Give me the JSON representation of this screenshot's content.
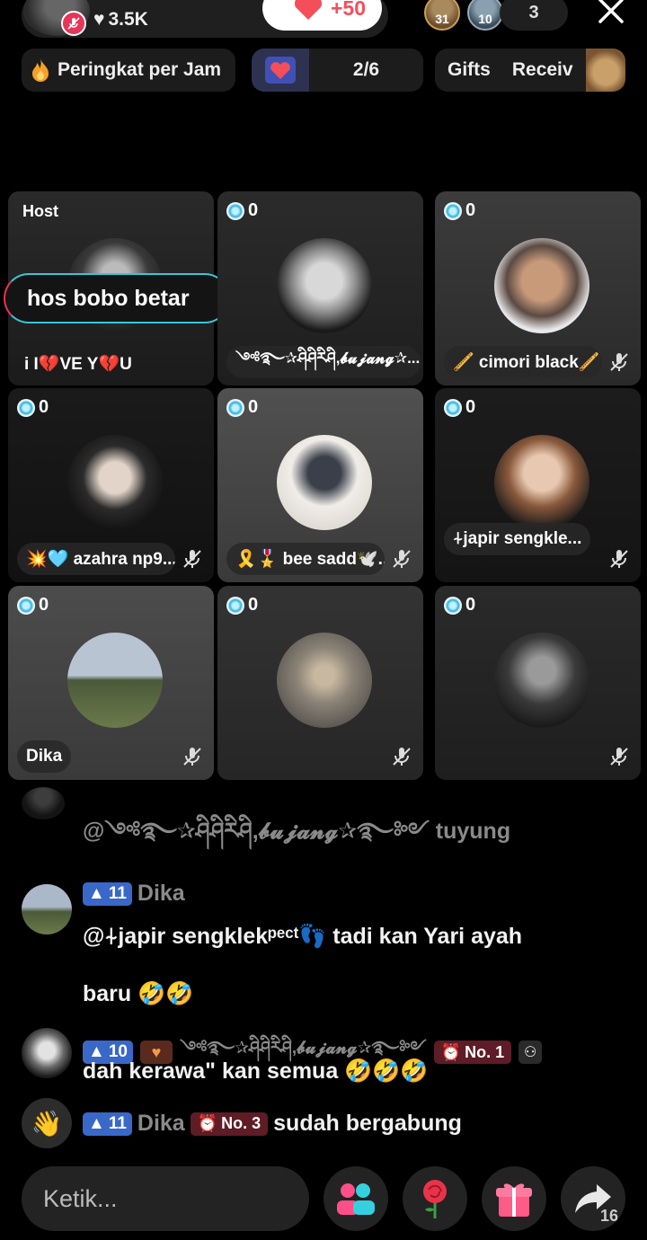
{
  "header": {
    "likes": "3.5K",
    "like_increment": "+50",
    "viewer_badges": [
      "31",
      "10"
    ],
    "viewer_count": "3"
  },
  "chips": {
    "ranking": "Peringkat per Jam",
    "goal_progress": "2/6",
    "gifts": "Gifts",
    "received": "Receiv"
  },
  "host": {
    "label": "Host",
    "speech": "hos bobo betar",
    "name": "i I💔VE Y💔U"
  },
  "seats": [
    {
      "count": "0",
      "name": "༺࿐✰ཤིཤིརིཤི,𝓫𝓾𝓳𝓪𝓷𝓰✰..."
    },
    {
      "count": "0",
      "name": "🪈 cimori black🪈"
    },
    {
      "count": "0",
      "name": "💥🩵 azahra np9..."
    },
    {
      "count": "0",
      "name": "🎗️🎖️ bee sadd🕊️..."
    },
    {
      "count": "0",
      "name": "⍭japir sengkle..."
    },
    {
      "count": "0",
      "name": "Dika"
    },
    {
      "count": "0",
      "name": ""
    },
    {
      "count": "0",
      "name": ""
    }
  ],
  "chat": {
    "msg0": {
      "text": "@༺࿐✰ཤིཤིརིཤི,𝓫𝓾𝓳𝓪𝓷𝓰✰࿐༻ tuyung"
    },
    "msg1": {
      "level": "11",
      "user": "Dika",
      "line1": "@⍭japir sengklekᵖᵉᶜᵗ👣 tadi kan Yari ayah",
      "line2": "baru 🤣🤣"
    },
    "msg2": {
      "level": "10",
      "user": "༺࿐✰ཤིཤིརིཤི,𝓫𝓾𝓳𝓪𝓷𝓰✰࿐༻",
      "rank": "No. 1",
      "text": "dah kerawa\" kan semua 🤣🤣🤣"
    },
    "msg3": {
      "level": "11",
      "user": "Dika",
      "rank": "No. 3",
      "text": "sudah bergabung"
    }
  },
  "bottom": {
    "input_placeholder": "Ketik...",
    "share_count": "16"
  },
  "colors": {
    "accent_pink": "#f44e5b",
    "accent_cyan": "#39c6d6",
    "level_blue": "#3a68c8"
  }
}
